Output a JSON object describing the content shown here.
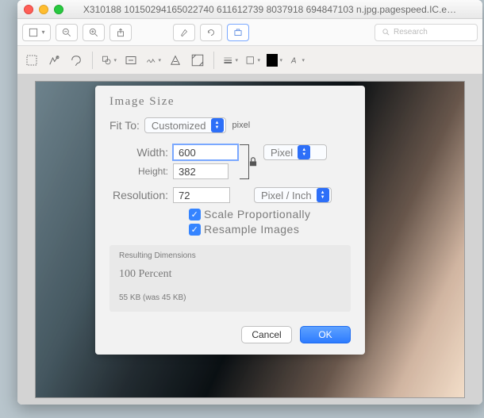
{
  "window": {
    "title": "X310188 1015029416502274​0 611612739 8037918 694847103 n.jpg.pagespeed.IC.e…"
  },
  "toolbar": {
    "search_placeholder": "Research"
  },
  "dialog": {
    "title": "Image Size",
    "fit_label": "Fit To:",
    "fit_value": "Customized",
    "fit_unit": "pixel",
    "width_label": "Width:",
    "width_value": "600",
    "width_unit": "Pixel",
    "height_label": "Height:",
    "height_value": "382",
    "resolution_label": "Resolution:",
    "resolution_value": "72",
    "resolution_unit": "Pixel / Inch",
    "scale_label": "Scale Proportionally",
    "resample_label": "Resample Images",
    "resulting_header": "Resulting Dimensions",
    "resulting_percent": "100 Percent",
    "resulting_size": "55 KB (was 45 KB)",
    "cancel": "Cancel",
    "ok": "OK"
  }
}
